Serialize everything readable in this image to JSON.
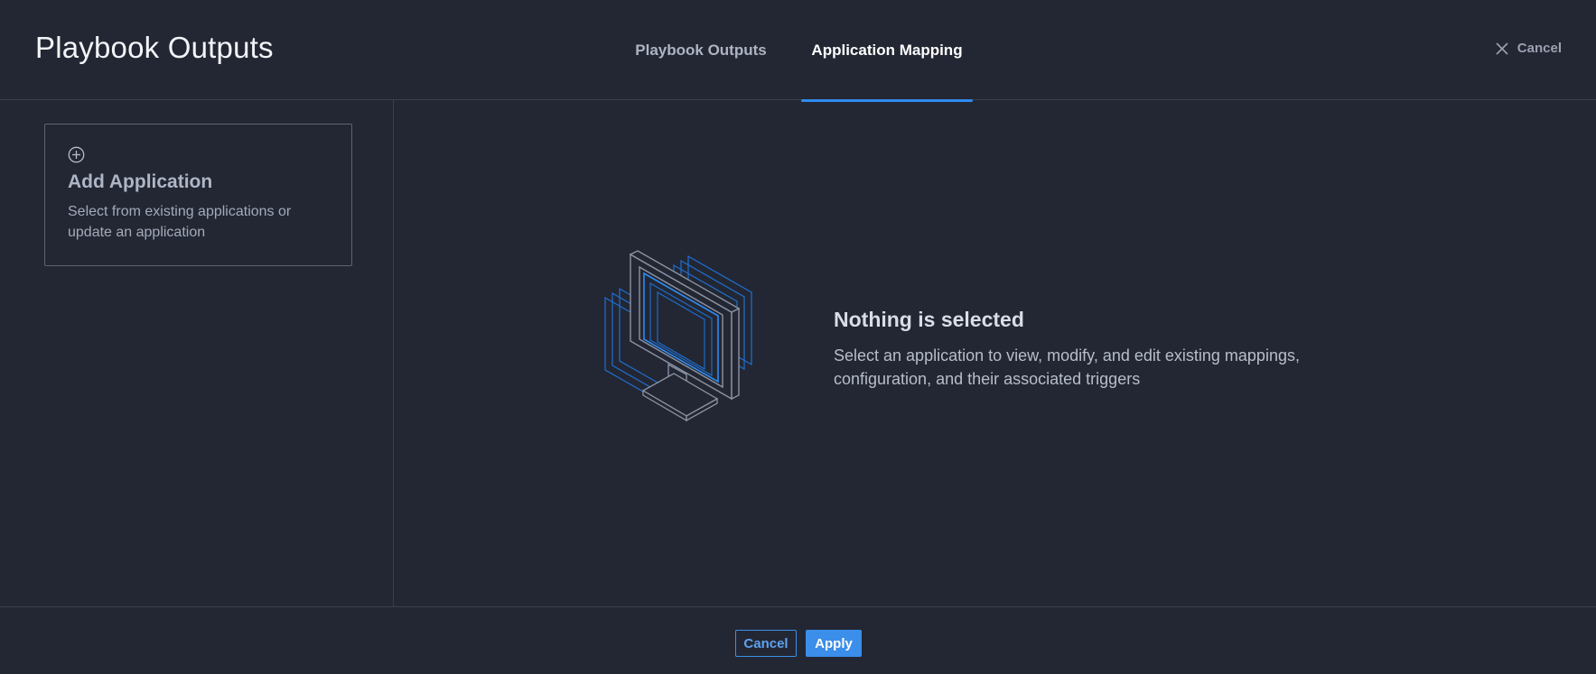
{
  "header": {
    "title": "Playbook Outputs",
    "tabs": [
      {
        "label": "Playbook Outputs",
        "active": false
      },
      {
        "label": "Application Mapping",
        "active": true
      }
    ],
    "cancel_label": "Cancel",
    "cancel_icon": "close-icon"
  },
  "sidebar": {
    "add_card": {
      "icon": "plus-circle-icon",
      "title": "Add Application",
      "description": "Select from existing applications or update an application"
    }
  },
  "main": {
    "illustration": "monitor-illustration",
    "empty_title": "Nothing is selected",
    "empty_description": "Select an application to view, modify, and edit existing mappings, configuration, and their associated triggers"
  },
  "footer": {
    "cancel_label": "Cancel",
    "apply_label": "Apply"
  },
  "colors": {
    "background": "#232733",
    "accent": "#2f8bf0",
    "divider": "#3a4050"
  }
}
